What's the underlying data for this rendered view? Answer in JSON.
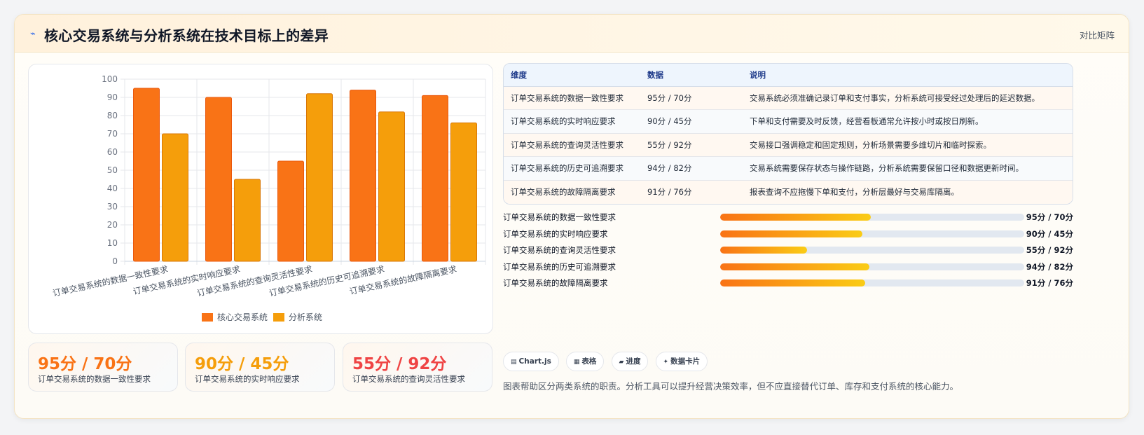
{
  "header": {
    "icon": "lightning-icon",
    "icon_glyph": "⌁",
    "title": "核心交易系统与分析系统在技术目标上的差异",
    "link_label": "对比矩阵"
  },
  "colors": {
    "core": "#f97316",
    "analysis": "#f59e0b",
    "stat_orange": "#f97316",
    "stat_amber": "#f59e0b",
    "stat_red": "#ef4444"
  },
  "chart_data": {
    "type": "bar",
    "categories": [
      "订单交易系统的数据一致性要求",
      "订单交易系统的实时响应要求",
      "订单交易系统的查询灵活性要求",
      "订单交易系统的历史可追溯要求",
      "订单交易系统的故障隔离要求"
    ],
    "series": [
      {
        "name": "核心交易系统",
        "values": [
          95,
          90,
          55,
          94,
          91
        ]
      },
      {
        "name": "分析系统",
        "values": [
          70,
          45,
          92,
          82,
          76
        ]
      }
    ],
    "ylim": [
      0,
      100
    ],
    "yticks": [
      0,
      10,
      20,
      30,
      40,
      50,
      60,
      70,
      80,
      90,
      100
    ],
    "grid": true,
    "legend": "bottom"
  },
  "table": {
    "headers": [
      "维度",
      "数据",
      "说明"
    ],
    "rows": [
      [
        "订单交易系统的数据一致性要求",
        "95分 / 70分",
        "交易系统必须准确记录订单和支付事实，分析系统可接受经过处理后的延迟数据。"
      ],
      [
        "订单交易系统的实时响应要求",
        "90分 / 45分",
        "下单和支付需要及时反馈，经营看板通常允许按小时或按日刷新。"
      ],
      [
        "订单交易系统的查询灵活性要求",
        "55分 / 92分",
        "交易接口强调稳定和固定规则，分析场景需要多维切片和临时探索。"
      ],
      [
        "订单交易系统的历史可追溯要求",
        "94分 / 82分",
        "交易系统需要保存状态与操作链路，分析系统需要保留口径和数据更新时间。"
      ],
      [
        "订单交易系统的故障隔离要求",
        "91分 / 76分",
        "报表查询不应拖慢下单和支付，分析层最好与交易库隔离。"
      ]
    ]
  },
  "progress": [
    {
      "label": "订单交易系统的数据一致性要求",
      "value": "95分 / 70分",
      "fraction": 0.495
    },
    {
      "label": "订单交易系统的实时响应要求",
      "value": "90分 / 45分",
      "fraction": 0.468
    },
    {
      "label": "订单交易系统的查询灵活性要求",
      "value": "55分 / 92分",
      "fraction": 0.286
    },
    {
      "label": "订单交易系统的历史可追溯要求",
      "value": "94分 / 82分",
      "fraction": 0.49
    },
    {
      "label": "订单交易系统的故障隔离要求",
      "value": "91分 / 76分",
      "fraction": 0.476
    }
  ],
  "stats": [
    {
      "value": "95分 / 70分",
      "label": "订单交易系统的数据一致性要求"
    },
    {
      "value": "90分 / 45分",
      "label": "订单交易系统的实时响应要求"
    },
    {
      "value": "55分 / 92分",
      "label": "订单交易系统的查询灵活性要求"
    }
  ],
  "pills": [
    {
      "icon": "chart-icon",
      "glyph": "▤",
      "label": "Chart.js"
    },
    {
      "icon": "table-icon",
      "glyph": "▦",
      "label": "表格"
    },
    {
      "icon": "progress-icon",
      "glyph": "▰",
      "label": "进度"
    },
    {
      "icon": "sparkle-icon",
      "glyph": "✦",
      "label": "数据卡片"
    }
  ],
  "footnote": "图表帮助区分两类系统的职责。分析工具可以提升经营决策效率，但不应直接替代订单、库存和支付系统的核心能力。"
}
